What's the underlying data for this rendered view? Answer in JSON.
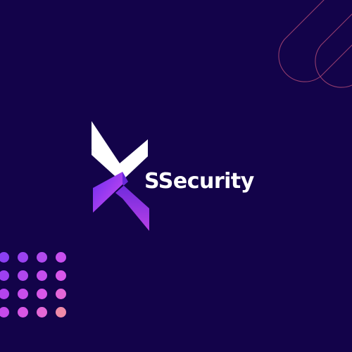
{
  "brand": {
    "name": "SSecurity",
    "logo": "x-mark-logo",
    "colors": {
      "background": "#13034a",
      "wordmark": "#ffffff",
      "logo_top": "#ffffff",
      "logo_bottom_start": "#6a2cf0",
      "logo_bottom_end": "#d24cf0",
      "accent_line": "#c0527a"
    }
  },
  "decor": {
    "dot_grid": {
      "rows": 4,
      "cols": 4,
      "colors": [
        [
          "#8b3ff2",
          "#9a42f0",
          "#b14aee",
          "#c84fee"
        ],
        [
          "#9d40f0",
          "#b047ee",
          "#c64eed",
          "#d857ea"
        ],
        [
          "#b344ee",
          "#c84dec",
          "#d957e8",
          "#e466d8"
        ],
        [
          "#c64aea",
          "#d856e4",
          "#e468d6",
          "#ef8aa8"
        ]
      ]
    },
    "pill_outlines": "rounded-line-icon"
  }
}
